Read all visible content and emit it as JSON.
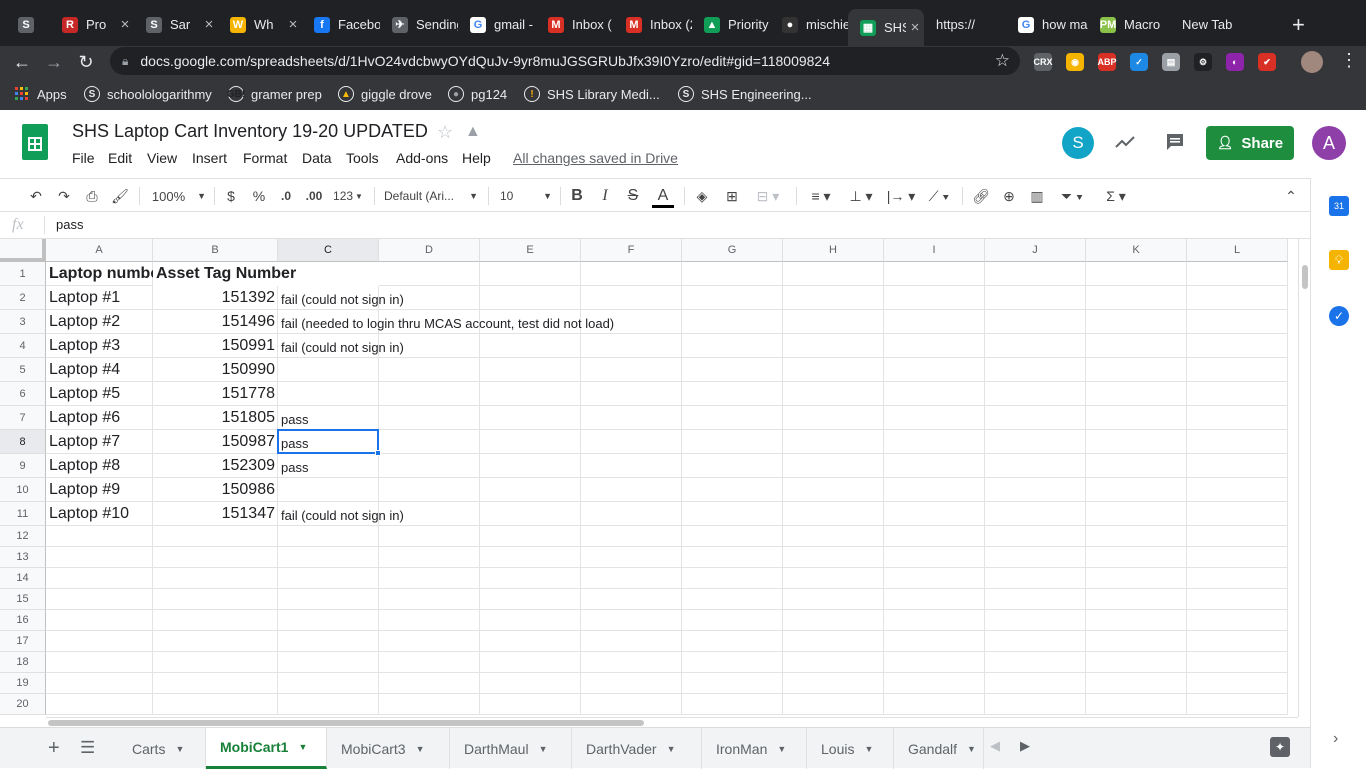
{
  "browser": {
    "tabs": [
      {
        "title": "",
        "icon": "S",
        "color": "#5f6368",
        "closable": false
      },
      {
        "title": "Pro",
        "icon": "R",
        "color": "#c62828",
        "closable": true
      },
      {
        "title": "Sar",
        "icon": "S",
        "color": "#5f6368",
        "closable": true
      },
      {
        "title": "Wh",
        "icon": "W",
        "color": "#f4b400",
        "closable": true
      },
      {
        "title": "Facebo",
        "icon": "f",
        "color": "#1877f2",
        "closable": false
      },
      {
        "title": "Sending",
        "icon": "✈",
        "color": "#5f6368",
        "closable": false
      },
      {
        "title": "gmail -",
        "icon": "G",
        "color": "#ffffff",
        "closable": false
      },
      {
        "title": "Inbox (",
        "icon": "M",
        "color": "#d93025",
        "closable": false
      },
      {
        "title": "Inbox (2",
        "icon": "M",
        "color": "#d93025",
        "closable": false
      },
      {
        "title": "Priority",
        "icon": "▲",
        "color": "#0f9d58",
        "closable": false
      },
      {
        "title": "mischie",
        "icon": "●",
        "color": "#333333",
        "closable": false
      },
      {
        "title": "SHS",
        "icon": "▦",
        "color": "#0f9d58",
        "closable": true
      },
      {
        "title": "https://",
        "icon": "",
        "color": "#202124",
        "closable": false
      },
      {
        "title": "how ma",
        "icon": "G",
        "color": "#ffffff",
        "closable": false
      },
      {
        "title": "Macro",
        "icon": "PM",
        "color": "#8bc34a",
        "closable": false
      },
      {
        "title": "New Tab",
        "icon": "",
        "color": "#202124",
        "closable": false
      }
    ],
    "new_tab_label": "+",
    "url": "docs.google.com/spreadsheets/d/1HvO24vdcbwyOYdQuJv-9yr8muJGSGRUbJfx39I0Yzro/edit#gid=118009824",
    "extensions": [
      {
        "label": "CRX",
        "color": "#5f6368"
      },
      {
        "label": "◉",
        "color": "#f4b400"
      },
      {
        "label": "ABP",
        "color": "#d93025"
      },
      {
        "label": "✓",
        "color": "#1e88e5"
      },
      {
        "label": "▤",
        "color": "#9aa0a6"
      },
      {
        "label": "⚙",
        "color": "#202124"
      },
      {
        "label": "◐",
        "color": "#8e24aa"
      },
      {
        "label": "✔",
        "color": "#d93025"
      }
    ],
    "bookmarks": [
      {
        "label": "Apps",
        "icon": "apps-grid"
      },
      {
        "label": "schoolologarithmy",
        "icon": "S"
      },
      {
        "label": "gramer prep",
        "icon": "GB!"
      },
      {
        "label": "giggle drove",
        "icon": "▲"
      },
      {
        "label": "pg124",
        "icon": "●"
      },
      {
        "label": "SHS Library Medi...",
        "icon": "!"
      },
      {
        "label": "SHS Engineering...",
        "icon": "S"
      }
    ]
  },
  "sheets": {
    "doc_title": "SHS Laptop Cart Inventory 19-20 UPDATED",
    "menus": [
      "File",
      "Edit",
      "View",
      "Insert",
      "Format",
      "Data",
      "Tools",
      "Add-ons",
      "Help"
    ],
    "saved_status": "All changes saved in Drive",
    "user_initial_s": "S",
    "share_label": "Share",
    "account_initial": "A",
    "toolbar": {
      "zoom": "100%",
      "currency": "$",
      "percent": "%",
      "decrease_decimals": ".0",
      "increase_decimals": ".00",
      "more_formats": "123",
      "font": "Default (Ari...",
      "font_size": "10",
      "bold": "B",
      "italic": "I",
      "strikethrough": "S",
      "text_color": "A"
    },
    "formula_bar": {
      "fx": "fx",
      "value": "pass"
    },
    "columns": [
      "A",
      "B",
      "C",
      "D",
      "E",
      "F",
      "G",
      "H",
      "I",
      "J",
      "K",
      "L"
    ],
    "rows": [
      "1",
      "2",
      "3",
      "4",
      "5",
      "6",
      "7",
      "8",
      "9",
      "10",
      "11",
      "12",
      "13",
      "14",
      "15",
      "16",
      "17",
      "18",
      "19",
      "20"
    ],
    "header": {
      "a": "Laptop number",
      "b": "Asset Tag Number"
    },
    "data": [
      {
        "a": "Laptop #1",
        "b": "151392",
        "c": "fail (could not sign in)"
      },
      {
        "a": "Laptop #2",
        "b": "151496",
        "c": "fail (needed to login thru MCAS account, test did not load)"
      },
      {
        "a": "Laptop #3",
        "b": "150991",
        "c": "fail (could not sign in)"
      },
      {
        "a": "Laptop #4",
        "b": "150990",
        "c": ""
      },
      {
        "a": "Laptop #5",
        "b": "151778",
        "c": ""
      },
      {
        "a": "Laptop #6",
        "b": "151805",
        "c": "pass"
      },
      {
        "a": "Laptop #7",
        "b": "150987",
        "c": "pass"
      },
      {
        "a": "Laptop #8",
        "b": "152309",
        "c": "pass"
      },
      {
        "a": "Laptop #9",
        "b": "150986",
        "c": ""
      },
      {
        "a": "Laptop #10",
        "b": "151347",
        "c": "fail (could not sign in)"
      }
    ],
    "selected_cell": "C8",
    "sheet_tabs": [
      "Carts",
      "MobiCart1",
      "MobiCart3",
      "DarthMaul",
      "DarthVader",
      "IronMan",
      "Louis",
      "Gandalf"
    ],
    "active_sheet": "MobiCart1",
    "colors": {
      "green": "#188038",
      "share_bg": "#1e8e3e",
      "selection": "#1a73e8",
      "avatar_purple": "#8e3fa8",
      "avatar_teal": "#12a4c6"
    }
  }
}
